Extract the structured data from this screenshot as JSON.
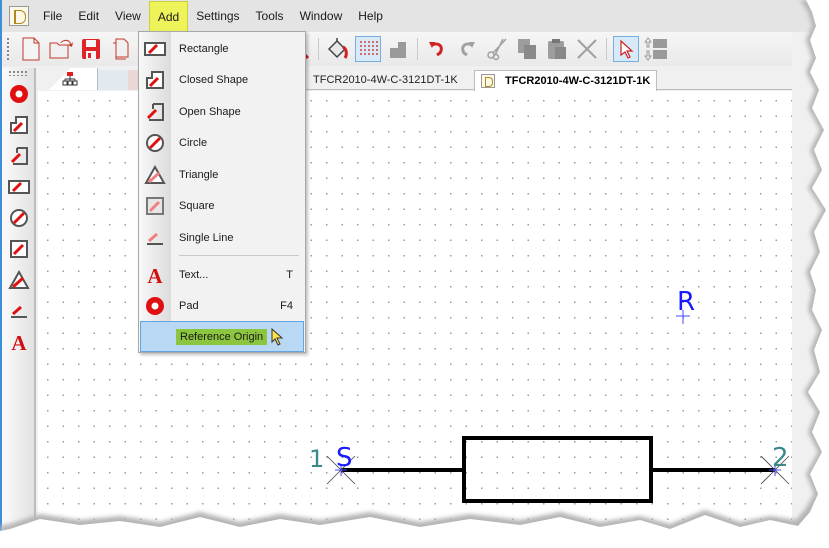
{
  "menubar": {
    "items": [
      "File",
      "Edit",
      "View",
      "Add",
      "Settings",
      "Tools",
      "Window",
      "Help"
    ],
    "active": "Add"
  },
  "toolbar": {
    "buttons": [
      {
        "name": "new-document",
        "icon": "new-document-icon"
      },
      {
        "name": "open",
        "icon": "open-folder-icon"
      },
      {
        "name": "save",
        "icon": "save-icon"
      },
      {
        "name": "copy-document",
        "icon": "copy-document-icon"
      },
      {
        "name": "zoom-out",
        "icon": "zoom-out-icon"
      },
      {
        "name": "fill",
        "icon": "paint-bucket-icon"
      },
      {
        "name": "grid",
        "icon": "grid-icon",
        "pressed": true
      },
      {
        "name": "snap",
        "icon": "snap-icon"
      },
      {
        "name": "undo",
        "icon": "undo-icon"
      },
      {
        "name": "redo",
        "icon": "redo-icon"
      },
      {
        "name": "cut",
        "icon": "scissors-icon"
      },
      {
        "name": "copy",
        "icon": "copy-icon"
      },
      {
        "name": "paste",
        "icon": "paste-icon"
      },
      {
        "name": "delete",
        "icon": "delete-x-icon"
      },
      {
        "name": "select",
        "icon": "select-arrow-icon",
        "pressed": true
      },
      {
        "name": "order",
        "icon": "bring-forward-icon"
      }
    ]
  },
  "toolbox": {
    "tools": [
      "pad",
      "closed-shape",
      "open-shape",
      "rectangle",
      "circle",
      "square",
      "triangle",
      "single-line",
      "text"
    ]
  },
  "tabs": {
    "inactive_label": "TFCR2010-4W-C-3121DT-1K",
    "active_label": "TFCR2010-4W-C-3121DT-1K"
  },
  "add_menu": {
    "items": [
      {
        "label": "Rectangle",
        "icon": "rectangle-icon",
        "shortcut": ""
      },
      {
        "label": "Closed Shape",
        "icon": "closed-shape-icon",
        "shortcut": ""
      },
      {
        "label": "Open Shape",
        "icon": "open-shape-icon",
        "shortcut": ""
      },
      {
        "label": "Circle",
        "icon": "circle-icon",
        "shortcut": ""
      },
      {
        "label": "Triangle",
        "icon": "triangle-icon",
        "shortcut": ""
      },
      {
        "label": "Square",
        "icon": "square-icon",
        "shortcut": ""
      },
      {
        "label": "Single Line",
        "icon": "single-line-icon",
        "shortcut": ""
      },
      {
        "label": "Text...",
        "icon": "text-icon",
        "shortcut": "T"
      },
      {
        "label": "Pad",
        "icon": "pad-icon",
        "shortcut": "F4"
      },
      {
        "label": "Reference Origin",
        "icon": "",
        "shortcut": "",
        "highlighted": true
      }
    ]
  },
  "schematic": {
    "pin1_number": "1",
    "pin1_name": "S",
    "pin2_number": "2",
    "ref_label": "R",
    "colors": {
      "pin_number": "#3a8a8c",
      "pin_name": "#1a1aff",
      "outline": "#000000"
    }
  }
}
